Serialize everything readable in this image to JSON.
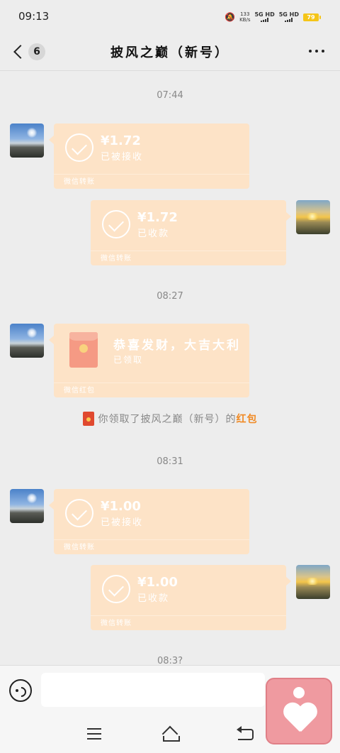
{
  "status_bar": {
    "time": "09:13",
    "net_speed_value": "133",
    "net_speed_unit": "KB/s",
    "signal1": "5G HD",
    "signal2": "5G HD",
    "battery": "79"
  },
  "header": {
    "unread_count": "6",
    "title": "披风之巅（新号）"
  },
  "messages": {
    "t1": "07:44",
    "m1": {
      "amount": "¥1.72",
      "status": "已被接收",
      "footer": "微信转账"
    },
    "m2": {
      "amount": "¥1.72",
      "status": "已收款",
      "footer": "微信转账"
    },
    "t2": "08:27",
    "m3": {
      "greeting": "恭喜发财，大吉大利",
      "status": "已领取",
      "footer": "微信红包"
    },
    "system": {
      "text": "你领取了披风之巅（新号）的",
      "link": "红包"
    },
    "t3": "08:31",
    "m4": {
      "amount": "¥1.00",
      "status": "已被接收",
      "footer": "微信转账"
    },
    "m5": {
      "amount": "¥1.00",
      "status": "已收款",
      "footer": "微信转账"
    },
    "t4": "08:3?"
  },
  "input": {
    "value": ""
  },
  "icons": [
    "back-chevron-icon",
    "more-icon",
    "check-circle-icon",
    "red-packet-icon",
    "voice-icon",
    "menu-icon",
    "home-icon",
    "back-icon",
    "heart-app-icon"
  ],
  "colors": {
    "bubble": "#fde3c7",
    "background": "#ededed",
    "link": "#f08a24",
    "overlay_app": "#ef9aa0"
  }
}
